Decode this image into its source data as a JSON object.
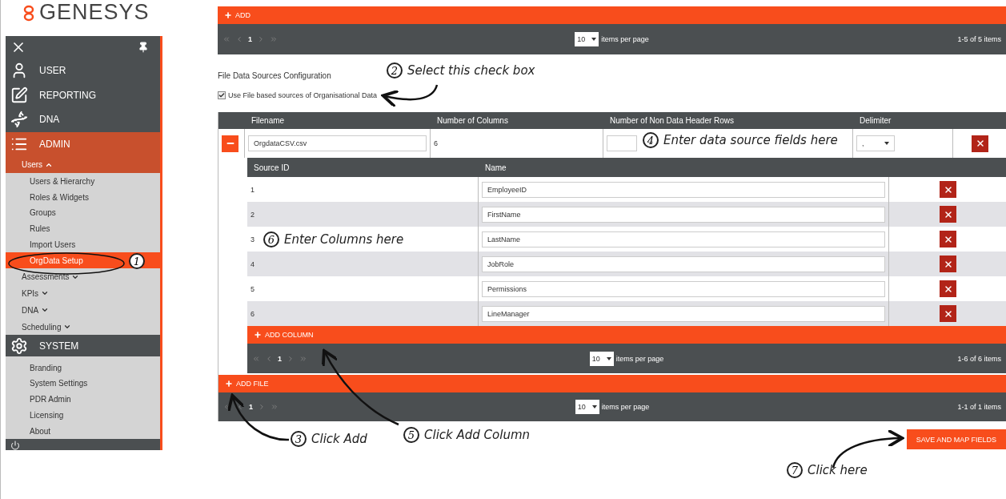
{
  "logo": {
    "text": "GENESYS"
  },
  "sidebar": {
    "nav": [
      {
        "label": "USER",
        "selected": false
      },
      {
        "label": "REPORTING",
        "selected": false
      },
      {
        "label": "DNA",
        "selected": false
      },
      {
        "label": "ADMIN",
        "selected": true,
        "children": [
          {
            "label": "Users",
            "kind": "group",
            "expanded": true,
            "children": [
              {
                "label": "Users & Hierarchy",
                "selected": false
              },
              {
                "label": "Roles & Widgets",
                "selected": false
              },
              {
                "label": "Groups",
                "selected": false
              },
              {
                "label": "Rules",
                "selected": false
              },
              {
                "label": "Import Users",
                "selected": false
              },
              {
                "label": "OrgData Setup",
                "selected": true
              }
            ]
          },
          {
            "label": "Assessments",
            "kind": "group",
            "expanded": false
          },
          {
            "label": "KPIs",
            "kind": "group",
            "expanded": false
          },
          {
            "label": "DNA",
            "kind": "group",
            "expanded": false
          },
          {
            "label": "Scheduling",
            "kind": "group",
            "expanded": false
          }
        ]
      },
      {
        "label": "SYSTEM",
        "selected": false,
        "children": [
          {
            "label": "Branding",
            "kind": "link"
          },
          {
            "label": "System Settings",
            "kind": "link"
          },
          {
            "label": "PDR Admin",
            "kind": "link"
          },
          {
            "label": "Licensing",
            "kind": "link"
          },
          {
            "label": "About",
            "kind": "link"
          }
        ]
      }
    ]
  },
  "top_grid": {
    "add_label": "ADD",
    "pager": {
      "page": "1",
      "page_size": "10",
      "per_page_label": "items per page",
      "summary": "1-5 of 5 items"
    }
  },
  "config": {
    "title": "File Data Sources Configuration",
    "checkbox": {
      "label": "Use File based sources of Organisational Data",
      "checked": true
    }
  },
  "files_table": {
    "columns": [
      "Filename",
      "Number of Columns",
      "Number of Non Data Header Rows",
      "Delimiter"
    ],
    "rows": [
      {
        "filename": "OrgdataCSV.csv",
        "column_count": "6",
        "delimiter": ",",
        "expanded": true,
        "columns_table": {
          "columns": [
            "Source ID",
            "Name"
          ],
          "rows": [
            {
              "source_id": "1",
              "name": "EmployeeID"
            },
            {
              "source_id": "2",
              "name": "FirstName"
            },
            {
              "source_id": "3",
              "name": "LastName"
            },
            {
              "source_id": "4",
              "name": "JobRole"
            },
            {
              "source_id": "5",
              "name": "Permissions"
            },
            {
              "source_id": "6",
              "name": "LineManager"
            }
          ],
          "add_label": "ADD COLUMN",
          "pager": {
            "page": "1",
            "page_size": "10",
            "per_page_label": "items per page",
            "summary": "1-6 of 6 items"
          }
        }
      }
    ],
    "add_label": "ADD FILE",
    "pager": {
      "page": "1",
      "page_size": "10",
      "per_page_label": "items per page",
      "summary": "1-1 of 1 items"
    }
  },
  "save_button": "SAVE AND MAP FIELDS",
  "annotations": [
    {
      "number": "1"
    },
    {
      "number": "2",
      "text": "Select this check box"
    },
    {
      "number": "3",
      "text": "Click Add"
    },
    {
      "number": "4",
      "text": "Enter data source fields here"
    },
    {
      "number": "5",
      "text": "Click Add Column"
    },
    {
      "number": "6",
      "text": "Enter Columns here"
    },
    {
      "number": "7",
      "text": "Click here"
    }
  ]
}
